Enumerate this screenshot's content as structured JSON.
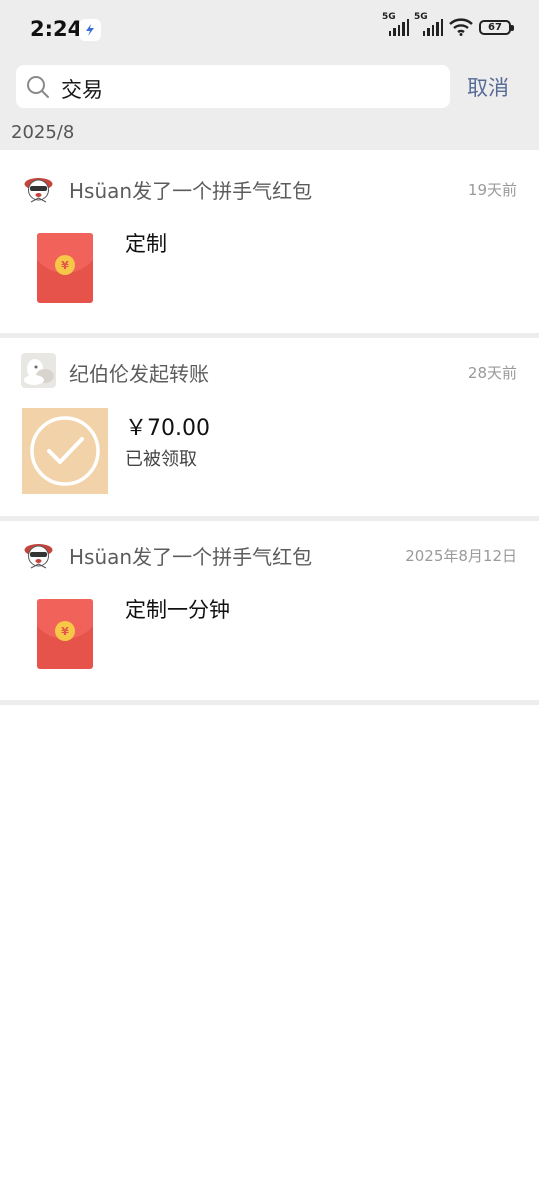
{
  "status_bar": {
    "time": "2:24",
    "network1": "5G",
    "network2": "5G",
    "battery": "67"
  },
  "search": {
    "query": "交易",
    "cancel_label": "取消"
  },
  "month_label": "2025/8",
  "records": [
    {
      "title": "Hsüan发了一个拼手气红包",
      "time": "19天前",
      "text": "定制",
      "type": "red-packet",
      "coin_symbol": "¥"
    },
    {
      "title": "纪伯伦发起转账",
      "time": "28天前",
      "amount": "￥70.00",
      "status": "已被领取",
      "type": "transfer"
    },
    {
      "title": "Hsüan发了一个拼手气红包",
      "time": "2025年8月12日",
      "text": "定制一分钟",
      "type": "red-packet",
      "coin_symbol": "¥"
    }
  ],
  "colors": {
    "background_gray": "#ededed",
    "link_blue": "#576b95",
    "red_packet": "#e5534b",
    "transfer_bg": "#f2d2a8"
  }
}
